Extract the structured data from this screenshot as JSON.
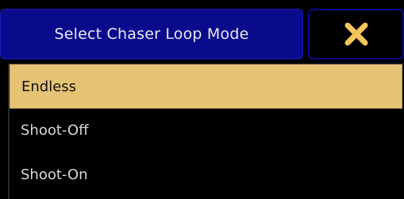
{
  "dialog": {
    "title": "Select Chaser Loop Mode",
    "close_icon": "close-x-icon"
  },
  "options": [
    {
      "label": "Endless",
      "selected": true
    },
    {
      "label": "Shoot-Off",
      "selected": false
    },
    {
      "label": "Shoot-On",
      "selected": false
    }
  ],
  "colors": {
    "title_bar": "#0a0a8c",
    "selected_bg": "#e6c275",
    "close_icon": "#f5c45a",
    "background": "#000000"
  }
}
